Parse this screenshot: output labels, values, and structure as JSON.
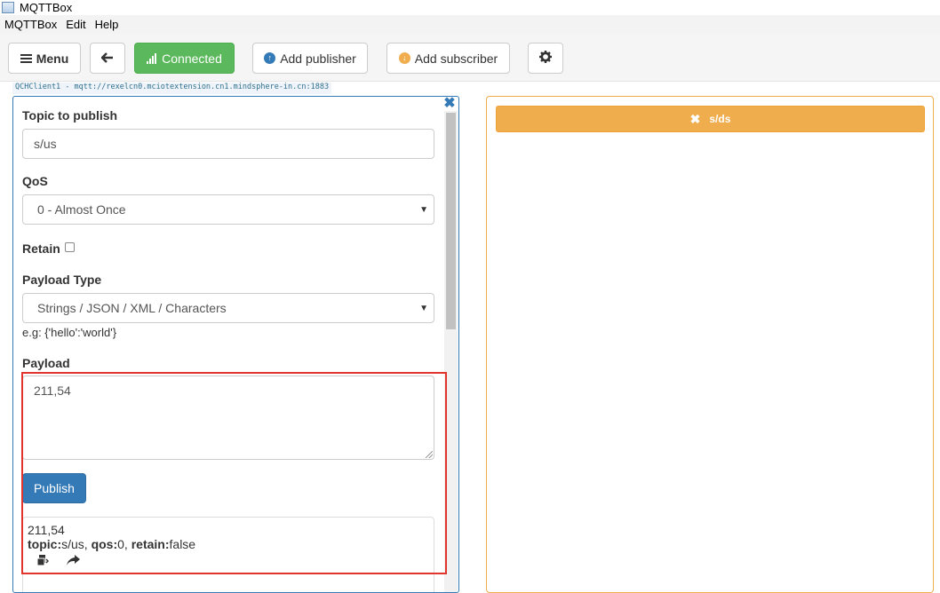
{
  "window": {
    "title": "MQTTBox"
  },
  "menubar": {
    "items": [
      "MQTTBox",
      "Edit",
      "Help"
    ]
  },
  "toolbar": {
    "menu_label": "Menu",
    "connected_label": "Connected",
    "add_publisher_label": "Add publisher",
    "add_subscriber_label": "Add subscriber"
  },
  "client": {
    "label": "QCHClient1 - mqtt://rexelcn0.mciotextension.cn1.mindsphere-in.cn:1883"
  },
  "publisher": {
    "topic_label": "Topic to publish",
    "topic_value": "s/us",
    "qos_label": "QoS",
    "qos_value": "0 - Almost Once",
    "retain_label": "Retain",
    "payload_type_label": "Payload Type",
    "payload_type_value": "Strings / JSON / XML / Characters",
    "payload_hint": "e.g: {'hello':'world'}",
    "payload_label": "Payload",
    "payload_value": "211,54",
    "publish_label": "Publish",
    "message": {
      "payload": "211,54",
      "topic_key": "topic:",
      "topic_value": "s/us, ",
      "qos_key": "qos:",
      "qos_value": "0, ",
      "retain_key": "retain:",
      "retain_value": "false"
    }
  },
  "subscriber": {
    "topic": "s/ds"
  },
  "colors": {
    "connected": "#5cb85c",
    "primary": "#337ab7",
    "warning": "#f0ad4e",
    "highlight": "#e0342c"
  }
}
